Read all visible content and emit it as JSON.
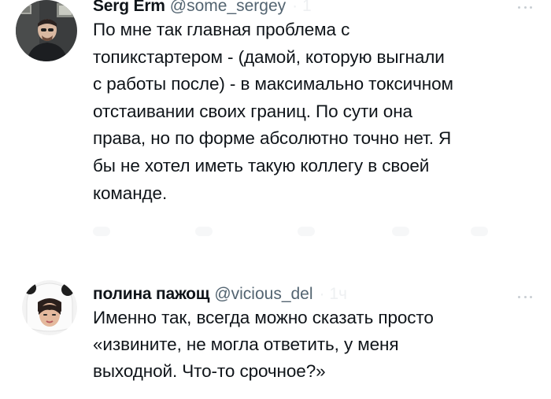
{
  "tweets": [
    {
      "author_name": "Serg Erm",
      "author_handle": "@some_sergey",
      "ghost_text": "· 1",
      "lines": [
        "По мне так главная проблема с",
        "топикстартером - (дамой, которую выгнали",
        "с работы после) - в максимально токсичном",
        "отстаивании своих границ. По сути она",
        "права, но по форме абсолютно точно нет. Я",
        "бы не хотел иметь такую коллегу в своей",
        "команде."
      ]
    },
    {
      "author_name": "полина пажощ",
      "author_handle": "@vicious_del",
      "ghost_text": "· 1ч",
      "lines": [
        "Именно так, всегда можно сказать просто",
        "«извините, не могла ответить, у меня",
        "выходной. Что-то срочное?»"
      ]
    }
  ],
  "icons": {
    "more": "more-horizontal-icon"
  },
  "colors": {
    "text": "#0f1419",
    "secondary": "#536471",
    "background": "#ffffff"
  }
}
